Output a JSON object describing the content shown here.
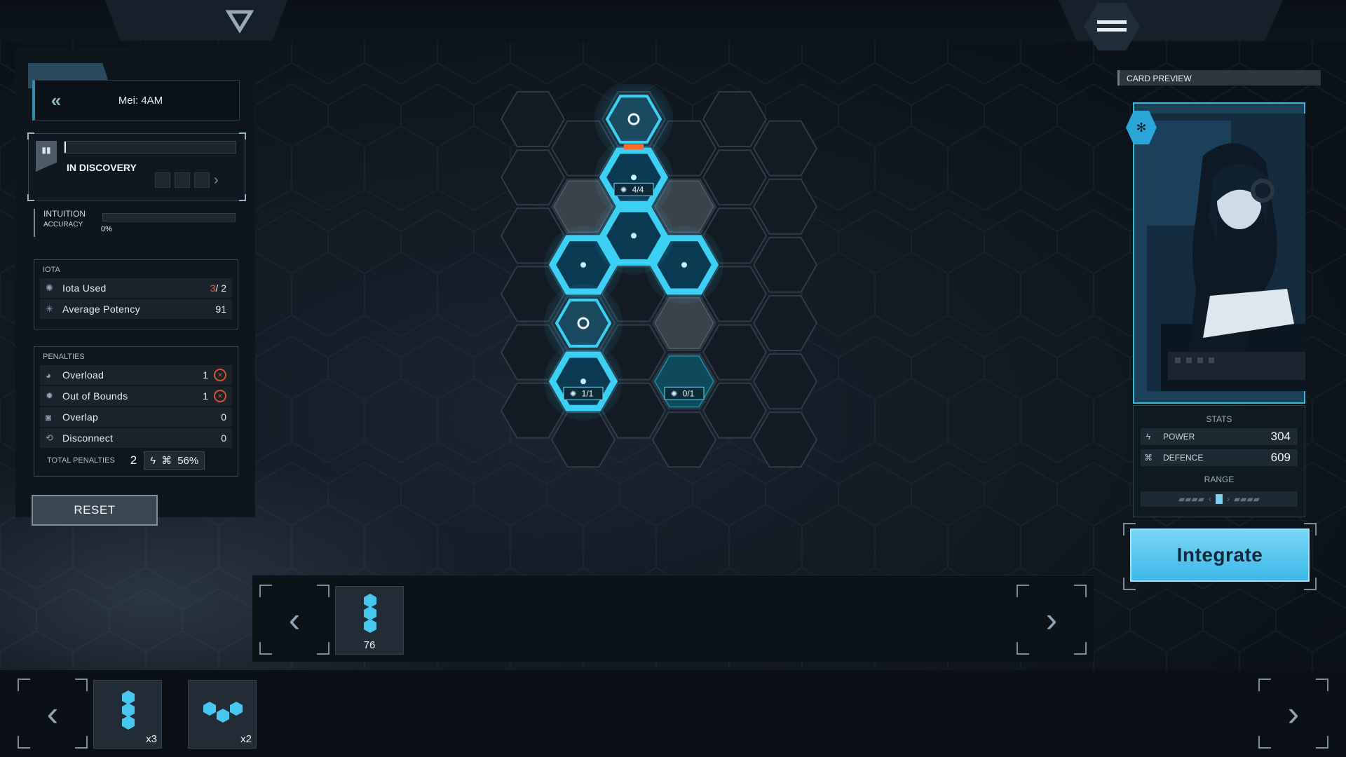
{
  "header": {
    "menu_icon": "hamburger-icon",
    "logo_icon": "hex-logo-icon"
  },
  "left": {
    "title": "Mei: 4AM",
    "discovery": {
      "status": "IN DISCOVERY",
      "progress": 0.01
    },
    "intuition": {
      "title": "INTUITION",
      "accuracy_label": "ACCURACY",
      "accuracy_value": "0%"
    },
    "iota": {
      "header": "IOTA",
      "rows": [
        {
          "label": "Iota Used",
          "used": "3",
          "sep": "/ ",
          "max": "2"
        },
        {
          "label": "Average Potency",
          "value": "91"
        }
      ]
    },
    "penalties": {
      "header": "PENALTIES",
      "rows": [
        {
          "label": "Overload",
          "value": "1"
        },
        {
          "label": "Out of Bounds",
          "value": "1"
        },
        {
          "label": "Overlap",
          "value": "0"
        },
        {
          "label": "Disconnect",
          "value": "0"
        }
      ],
      "total_label": "TOTAL PENALTIES",
      "total_value": "2",
      "total_percent": "56%"
    },
    "reset_label": "RESET"
  },
  "board": {
    "badges": [
      "4/4",
      "1/1",
      "0/1"
    ]
  },
  "tray": {
    "items": [
      {
        "name": "straight-piece",
        "count": "76"
      }
    ]
  },
  "bottom": {
    "items": [
      {
        "name": "straight-piece",
        "count": "x3"
      },
      {
        "name": "triangle-piece",
        "count": "x2"
      }
    ]
  },
  "card_preview": {
    "header": "CARD PREVIEW",
    "stats_label": "STATS",
    "power_label": "POWER",
    "power": "304",
    "defence_label": "DEFENCE",
    "defence": "609",
    "range_label": "RANGE",
    "integrate_label": "Integrate"
  },
  "colors": {
    "accent": "#3cc8f0",
    "penalty": "#ff5a3c"
  }
}
